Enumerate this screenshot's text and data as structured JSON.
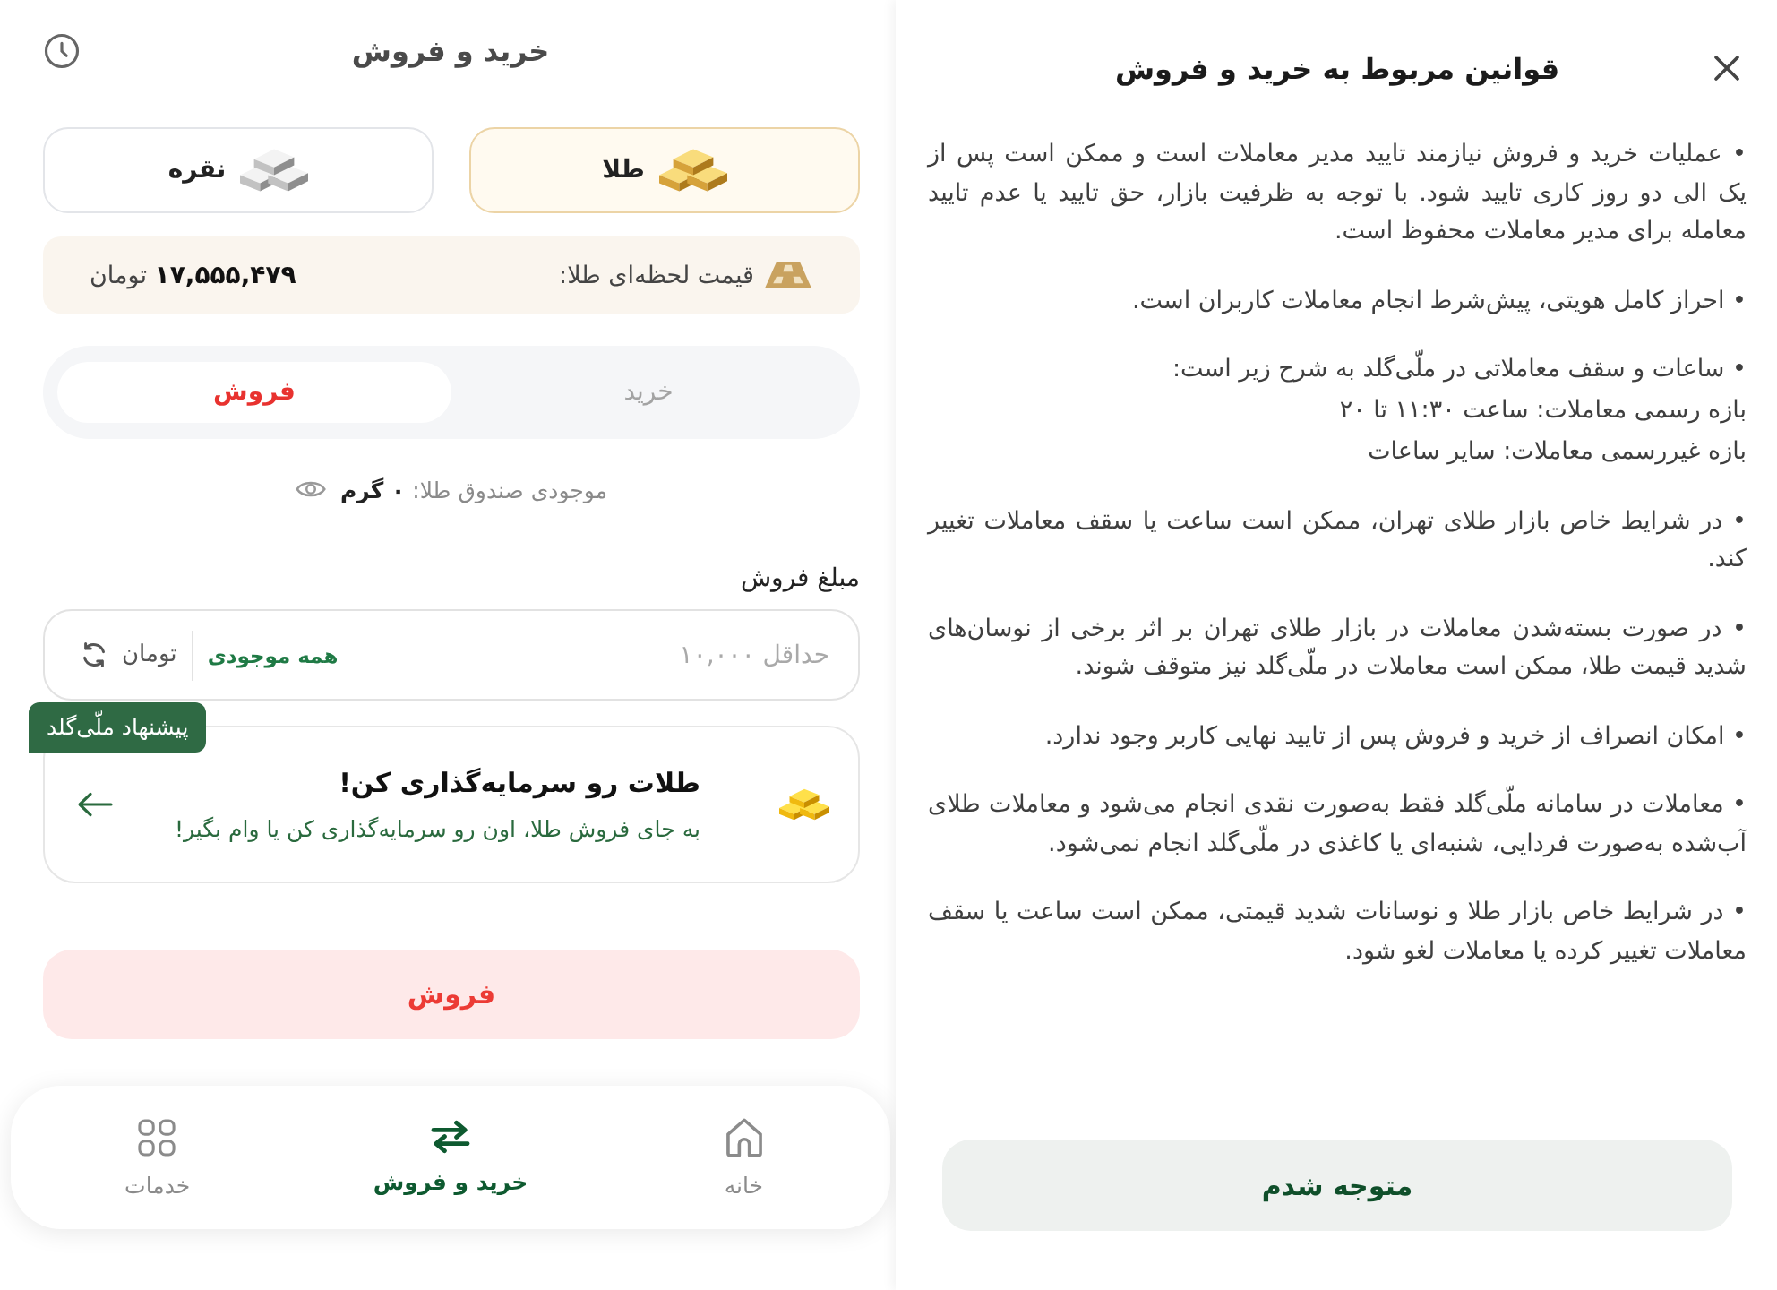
{
  "page": {
    "title": "خرید و فروش"
  },
  "metals": [
    {
      "label": "طلا",
      "kind": "gold",
      "selected": true
    },
    {
      "label": "نقره",
      "kind": "silver",
      "selected": false
    }
  ],
  "price": {
    "label": "قیمت لحظه‌ای طلا:",
    "value": "**۱۷,۵۵۵,۴۷۹** تومان"
  },
  "trade_tabs": [
    {
      "label": "خرید",
      "kind": "buy",
      "selected": false
    },
    {
      "label": "فروش",
      "kind": "sell",
      "selected": true
    }
  ],
  "balance": {
    "text": "موجودی صندوق طلا: **۰ گرم**"
  },
  "amount": {
    "label": "مبلغ فروش",
    "placeholder": "حداقل ۱۰,۰۰۰",
    "all_button": "همه موجودی",
    "unit": "تومان"
  },
  "offer": {
    "badge": "پیشنهاد ملّی‌گلد",
    "title": "طلات رو سرمایه‌گذاری کن!",
    "subtitle": "به جای فروش طلا، اون رو سرمایه‌گذاری کن یا وام بگیر!"
  },
  "submit": {
    "label": "فروش"
  },
  "bottom_nav": [
    {
      "label": "خانه",
      "kind": "home",
      "selected": false
    },
    {
      "label": "خرید و فروش",
      "kind": "trade",
      "selected": true
    },
    {
      "label": "خدمات",
      "kind": "services",
      "selected": false
    }
  ],
  "rules_panel": {
    "title": "قوانین مربوط به خرید و فروش",
    "rules": [
      {
        "text": "• عملیات خرید و فروش نیازمند تایید مدیر معاملات است و ممکن است پس از یک الی دو روز کاری تایید شود. با توجه به ظرفیت بازار، حق تایید یا عدم تایید معامله برای مدیر معاملات محفوظ است."
      },
      {
        "text": "• احراز کامل هویتی، پیش‌شرط انجام معاملات کاربران است."
      },
      {
        "text": "• ساعات و سقف معاملاتی در ملّی‌گلد به شرح زیر است:",
        "details": [
          "بازه رسمی معاملات: ساعت ۱۱:۳۰ تا ۲۰",
          "بازه غیررسمی معاملات: سایر ساعات"
        ]
      },
      {
        "text": "• در شرایط خاص بازار طلای تهران، ممکن است ساعت یا سقف معاملات تغییر کند."
      },
      {
        "text": "• در صورت بسته‌شدن معاملات در بازار طلای تهران بر اثر برخی از نوسان‌های شدید قیمت طلا، ممکن است معاملات در ملّی‌گلد نیز متوقف شوند."
      },
      {
        "text": "• امکان انصراف از خرید و فروش پس از تایید نهایی کاربر وجود ندارد."
      },
      {
        "text": "• معاملات در سامانه ملّی‌گلد فقط به‌صورت نقدی انجام می‌شود و معاملات طلای آب‌شده به‌صورت فردایی، شنبه‌ای یا کاغذی در ملّی‌گلد انجام نمی‌شود."
      },
      {
        "text": "• در شرایط خاص بازار طلا و نوسانات شدید قیمتی، ممکن است ساعت یا سقف معاملات تغییر کرده یا معاملات لغو شود."
      }
    ],
    "button": "متوجه شدم"
  }
}
